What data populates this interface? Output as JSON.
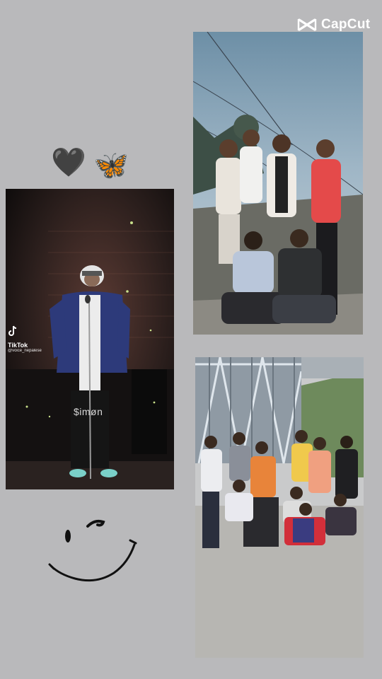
{
  "watermark": {
    "brand": "CapCut",
    "icon": "capcut-logo-icon"
  },
  "stickers": {
    "heart": "🖤",
    "butterfly": "🦋"
  },
  "stage_photo": {
    "tiktok_label": "TikTok",
    "tiktok_user": "@voice_nepalese",
    "caption": "$imøn"
  },
  "colors": {
    "background": "#b9b9bb",
    "hoodie": "#2d3a7a",
    "red_shirt": "#e44a4a",
    "orange_shirt": "#e8843a"
  }
}
